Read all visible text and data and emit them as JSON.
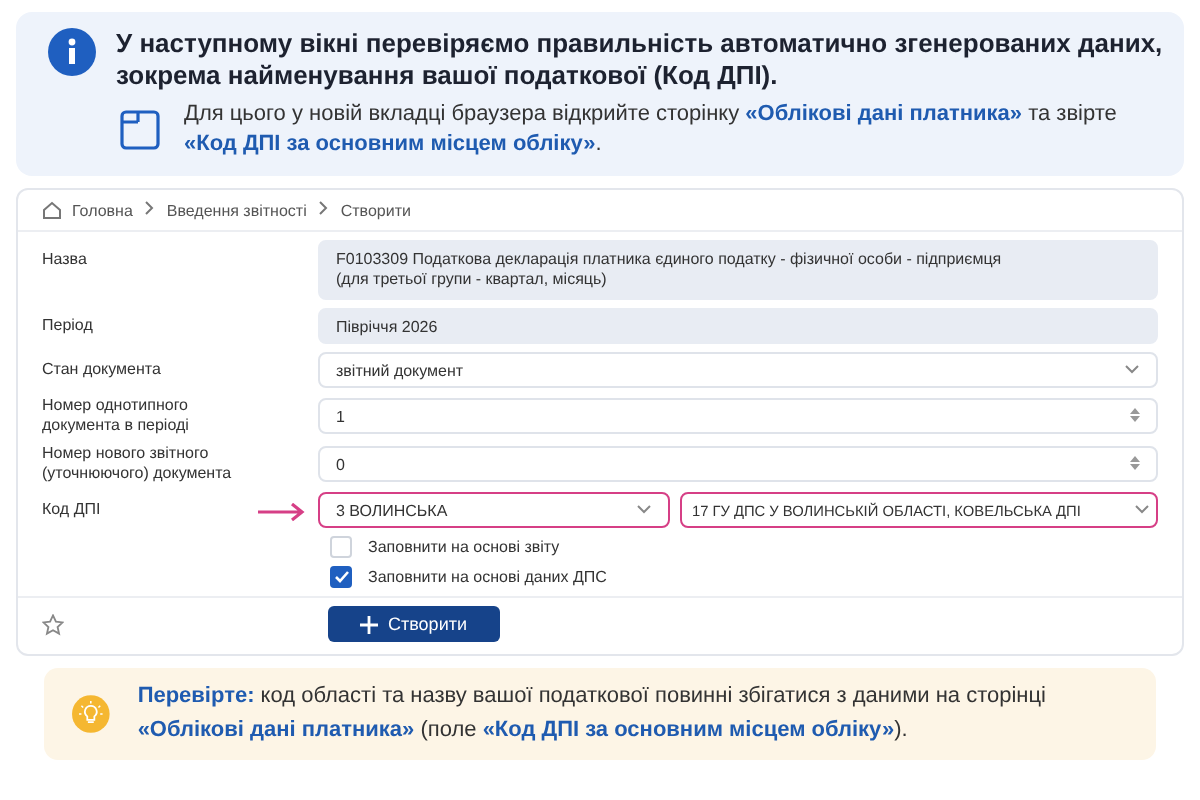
{
  "info": {
    "title": "У наступному вікні перевіряємо правильність автоматично згенерованих даних, зокрема найменування вашої податкової (Код ДПІ).",
    "text": "Для цього у новій вкладці браузера відкрийте сторінку **«Облікові дані платника»** та звірте **«Код ДПІ за основним місцем обліку»**."
  },
  "breadcrumbs": [
    "Головна",
    "Введення звітності",
    "Створити"
  ],
  "fields": [
    {
      "kind": "readonly",
      "label": "Назва",
      "value": "F0103309 Податкова декларація платника єдиного податку - фізичної особи - підприємця\n(для третьої групи - квартал, місяць)"
    },
    {
      "kind": "readonly",
      "label": "Період",
      "value": "Півріччя 2026"
    },
    {
      "kind": "select",
      "label": "Стан документа",
      "value": "звітний документ"
    },
    {
      "kind": "number",
      "label": "Номер однотипного документа в періоді",
      "value": "1"
    },
    {
      "kind": "number",
      "label": "Номер нового звітного (уточнюючого) документа",
      "value": "0"
    },
    {
      "kind": "select-pair",
      "label": "Код ДПІ",
      "value": "3 ВОЛИНСЬКА",
      "value_2": "17 ГУ ДПС У ВОЛИНСЬКІЙ ОБЛАСТІ, КОВЕЛЬСЬКА ДПІ",
      "highlighted": true
    }
  ],
  "options": [
    {
      "label": "Заповнити на основі звіту",
      "checked": false
    },
    {
      "label": "Заповнити на основі даних ДПС",
      "checked": true
    }
  ],
  "create_button": "Створити",
  "tip": {
    "text": "**Перевірте:** код області та назву вашої податкової повинні збігатися з даними на сторінці **«Облікові дані платника»** (поле **«Код ДПІ за основним місцем обліку»**)."
  }
}
